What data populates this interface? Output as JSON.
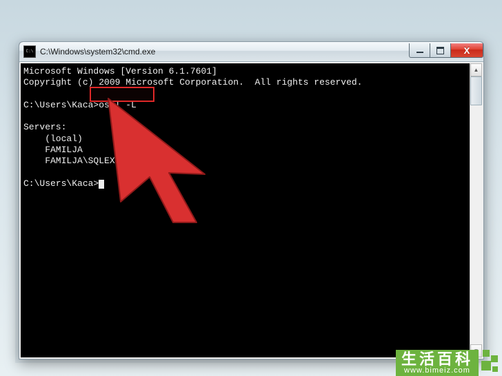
{
  "window": {
    "title": "C:\\Windows\\system32\\cmd.exe"
  },
  "controls": {
    "close_glyph": "X"
  },
  "console": {
    "line1": "Microsoft Windows [Version 6.1.7601]",
    "line2": "Copyright (c) 2009 Microsoft Corporation.  All rights reserved.",
    "blank1": "",
    "prompt1_path": "C:\\Users\\Kaca>",
    "prompt1_cmd": "osql -L",
    "blank2": "",
    "servers_header": "Servers:",
    "server1": "    (local)",
    "server2": "    FAMILJA",
    "server3": "    FAMILJA\\SQLEXPRESS",
    "blank3": "",
    "prompt2_path": "C:\\Users\\Kaca>"
  },
  "watermark": {
    "cn": "生活百科",
    "url": "www.bimeiz.com"
  }
}
